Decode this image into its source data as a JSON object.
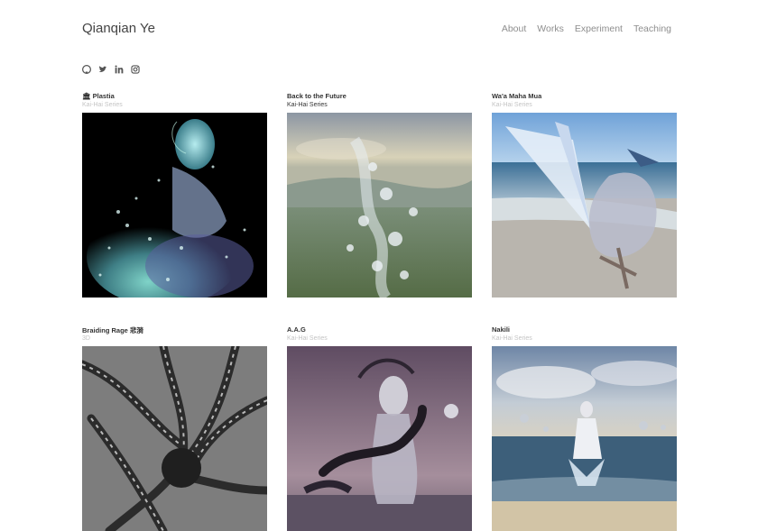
{
  "site": {
    "name": "Qianqian Ye"
  },
  "nav": {
    "items": [
      "About",
      "Works",
      "Experiment",
      "Teaching"
    ]
  },
  "social": [
    "github-icon",
    "twitter-icon",
    "linkedin-icon",
    "instagram-icon"
  ],
  "works": [
    {
      "title": "🏛 Plastia",
      "series": "Kai-Hai Series"
    },
    {
      "title": "Back to the Future",
      "series": "Kai-Hai Series"
    },
    {
      "title": "Wa'a Maha Mua",
      "series": "Kai-Hai Series"
    },
    {
      "title": "Braiding Rage 悲漪",
      "series": "3D"
    },
    {
      "title": "A.A.G",
      "series": "Kai-Hai Series"
    },
    {
      "title": "Nakili",
      "series": "Kai-Hai Series"
    }
  ]
}
